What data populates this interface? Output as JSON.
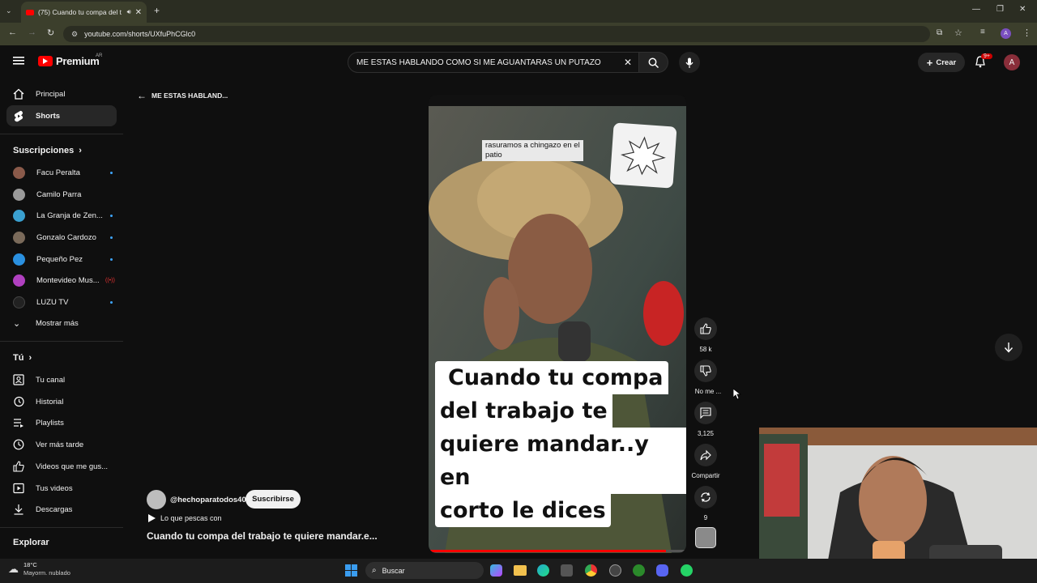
{
  "browser": {
    "tab_title": "(75) Cuando tu compa del t",
    "url": "youtube.com/shorts/UXfuPhCGlc0"
  },
  "yt": {
    "logo_text": "Premium",
    "logo_region": "AR",
    "search_value": "ME ESTAS HABLANDO COMO SI ME AGUANTARAS UN PUTAZO",
    "create_label": "Crear",
    "notif_badge": "9+",
    "avatar_letter": "A"
  },
  "sidebar": {
    "nav": [
      {
        "label": "Principal",
        "icon": "home-icon"
      },
      {
        "label": "Shorts",
        "icon": "shorts-icon"
      }
    ],
    "subs_title": "Suscripciones",
    "subs": [
      {
        "label": "Facu Peralta",
        "color": "#8a5a4a"
      },
      {
        "label": "Camilo Parra",
        "color": "#9a9a9a"
      },
      {
        "label": "La Granja de Zen...",
        "color": "#3aa0d0"
      },
      {
        "label": "Gonzalo Cardozo",
        "color": "#7a6a5a"
      },
      {
        "label": "Pequeño Pez",
        "color": "#2a90e0"
      },
      {
        "label": "Montevideo Mus...",
        "color": "#b040c0"
      },
      {
        "label": "LUZU TV",
        "color": "#222222"
      }
    ],
    "show_more": "Mostrar más",
    "you_title": "Tú",
    "you_items": [
      {
        "label": "Tu canal"
      },
      {
        "label": "Historial"
      },
      {
        "label": "Playlists"
      },
      {
        "label": "Ver más tarde"
      },
      {
        "label": "Videos que me gus..."
      },
      {
        "label": "Tus videos"
      },
      {
        "label": "Descargas"
      }
    ],
    "explore_title": "Explorar"
  },
  "short": {
    "back_label": "ME ESTAS HABLAND...",
    "caption_small_1": "rasuramos a chingazo en el",
    "caption_small_2": "patio",
    "caption_line1": "Cuando tu compa",
    "caption_line2": "del trabajo te",
    "caption_line3": "quiere mandar..y en",
    "caption_line4": "corto le  dices",
    "channel": "@hechoparatodos40",
    "subscribe": "Suscribirse",
    "sound": "Lo que pescas con",
    "title": "Cuando tu compa del trabajo te quiere mandar.e...",
    "likes": "58 k",
    "dislike": "No me ...",
    "comments": "3,125",
    "share": "Compartir",
    "remix": "9"
  },
  "taskbar": {
    "temp": "18°C",
    "weather": "Mayorm. nublado",
    "search": "Buscar"
  }
}
